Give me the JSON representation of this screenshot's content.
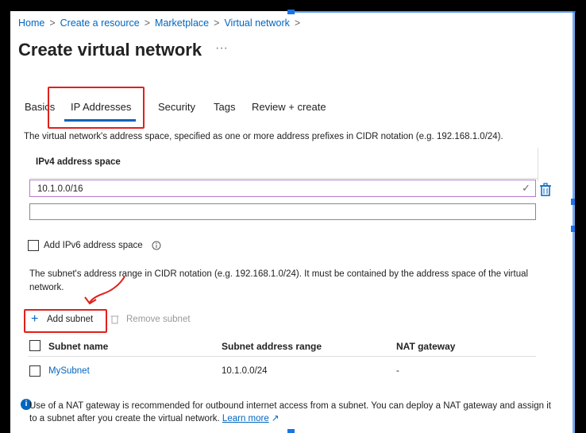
{
  "breadcrumb": {
    "items": [
      "Home",
      "Create a resource",
      "Marketplace",
      "Virtual network"
    ],
    "sep": ">"
  },
  "page": {
    "title": "Create virtual network",
    "more": "···"
  },
  "tabs": [
    {
      "label": "Basics",
      "active": false
    },
    {
      "label": "IP Addresses",
      "active": true
    },
    {
      "label": "Security",
      "active": false
    },
    {
      "label": "Tags",
      "active": false
    },
    {
      "label": "Review + create",
      "active": false
    }
  ],
  "address_space": {
    "description": "The virtual network's address space, specified as one or more address prefixes in CIDR notation (e.g. 192.168.1.0/24).",
    "header": "IPv4 address space",
    "value": "10.1.0.0/16",
    "empty_value": ""
  },
  "ipv6": {
    "label": "Add IPv6 address space",
    "info_icon": "info-icon",
    "checked": false
  },
  "subnet_desc": "The subnet's address range in CIDR notation (e.g. 192.168.1.0/24). It must be contained by the address space of the virtual network.",
  "toolbar": {
    "add_label": "Add subnet",
    "remove_label": "Remove subnet"
  },
  "subnet_table": {
    "columns": [
      "Subnet name",
      "Subnet address range",
      "NAT gateway"
    ],
    "rows": [
      {
        "name": "MySubnet",
        "range": "10.1.0.0/24",
        "nat": "-"
      }
    ]
  },
  "info_note": {
    "text": "Use of a NAT gateway is recommended for outbound internet access from a subnet. You can deploy a NAT gateway and assign it to a subnet after you create the virtual network.",
    "link": "Learn more"
  },
  "colors": {
    "link": "#0066c0",
    "annotation": "#e0201c",
    "selection_marks": "#1a73e8"
  }
}
